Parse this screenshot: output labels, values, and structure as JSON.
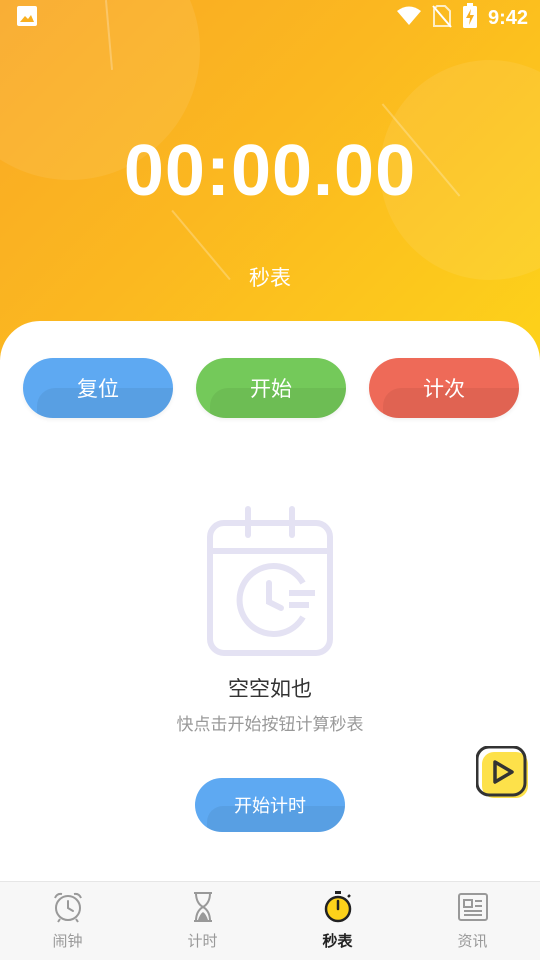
{
  "status_bar": {
    "time": "9:42",
    "icons": [
      "image-icon",
      "wifi-icon",
      "no-sim-icon",
      "battery-charging-icon"
    ]
  },
  "stopwatch": {
    "display": "00:00.00",
    "title": "秒表"
  },
  "controls": {
    "reset_label": "复位",
    "start_label": "开始",
    "lap_label": "计次"
  },
  "empty_state": {
    "icon": "calendar-clock-icon",
    "title": "空空如也",
    "hint": "快点击开始按钮计算秒表",
    "button_label": "开始计时"
  },
  "floating": {
    "icon": "play-icon"
  },
  "tabs": [
    {
      "label": "闹钟",
      "icon": "alarm-clock-icon",
      "active": false
    },
    {
      "label": "计时",
      "icon": "hourglass-icon",
      "active": false
    },
    {
      "label": "秒表",
      "icon": "stopwatch-icon",
      "active": true
    },
    {
      "label": "资讯",
      "icon": "news-icon",
      "active": false
    }
  ],
  "colors": {
    "header_gradient_start": "#f9a825",
    "header_gradient_end": "#fdd21a",
    "reset": "#5ea9f2",
    "start": "#74c95a",
    "lap": "#ee6a58"
  }
}
